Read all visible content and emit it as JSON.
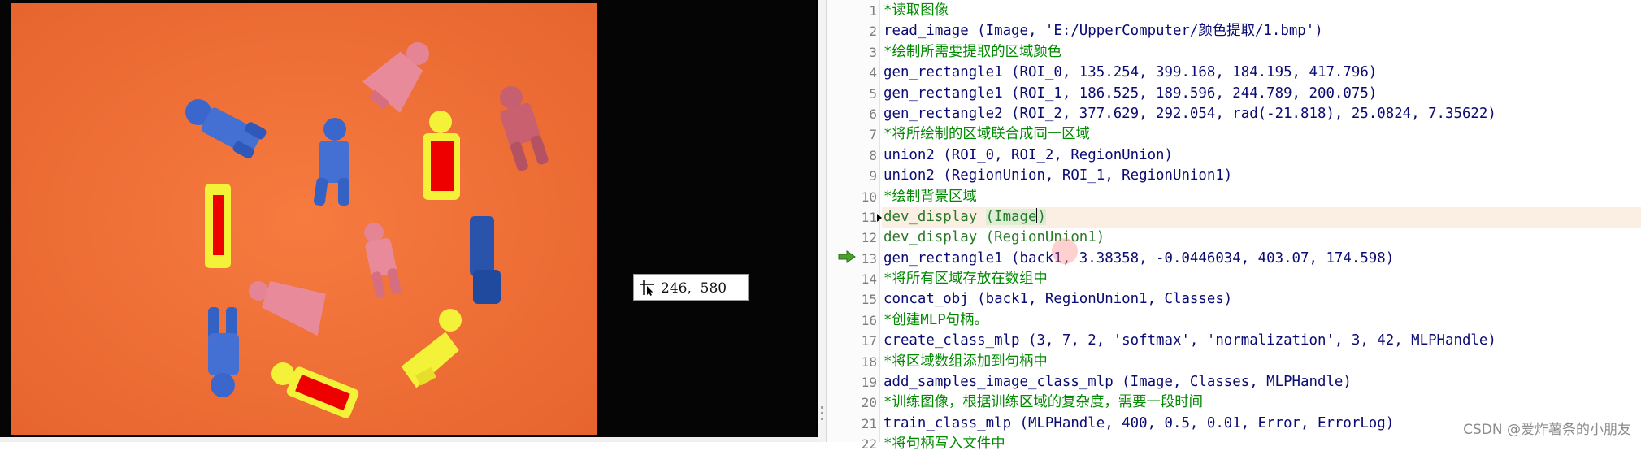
{
  "viewer": {
    "coord_readout": "246,  580"
  },
  "editor": {
    "lines": [
      {
        "n": "1",
        "text": "*读取图像",
        "kind": "comment"
      },
      {
        "n": "2",
        "text": "read_image (Image, 'E:/UpperComputer/颜色提取/1.bmp')",
        "kind": "call"
      },
      {
        "n": "3",
        "text": "*绘制所需要提取的区域颜色",
        "kind": "comment"
      },
      {
        "n": "4",
        "text": "gen_rectangle1 (ROI_0, 135.254, 399.168, 184.195, 417.796)",
        "kind": "call"
      },
      {
        "n": "5",
        "text": "gen_rectangle1 (ROI_1, 186.525, 189.596, 244.789, 200.075)",
        "kind": "call"
      },
      {
        "n": "6",
        "text": "gen_rectangle2 (ROI_2, 377.629, 292.054, rad(-21.818), 25.0824, 7.35622)",
        "kind": "call"
      },
      {
        "n": "7",
        "text": "*将所绘制的区域联合成同一区域",
        "kind": "comment"
      },
      {
        "n": "8",
        "text": "union2 (ROI_0, ROI_2, RegionUnion)",
        "kind": "call"
      },
      {
        "n": "9",
        "text": "union2 (RegionUnion, ROI_1, RegionUnion1)",
        "kind": "call"
      },
      {
        "n": "10",
        "text": "*绘制背景区域",
        "kind": "comment"
      },
      {
        "n": "11",
        "text": "dev_display (Image)",
        "kind": "struck",
        "current": true
      },
      {
        "n": "12",
        "text": "dev_display (RegionUnion1)",
        "kind": "struck"
      },
      {
        "n": "13",
        "text": "gen_rectangle1 (back1, 3.38358, -0.0446034, 403.07, 174.598)",
        "kind": "call",
        "exec": true
      },
      {
        "n": "14",
        "text": "*将所有区域存放在数组中",
        "kind": "comment"
      },
      {
        "n": "15",
        "text": "concat_obj (back1, RegionUnion1, Classes)",
        "kind": "call"
      },
      {
        "n": "16",
        "text": "*创建MLP句柄。",
        "kind": "comment"
      },
      {
        "n": "17",
        "text": "create_class_mlp (3, 7, 2, 'softmax', 'normalization', 3, 42, MLPHandle)",
        "kind": "call"
      },
      {
        "n": "18",
        "text": "*将区域数组添加到句柄中",
        "kind": "comment"
      },
      {
        "n": "19",
        "text": "add_samples_image_class_mlp (Image, Classes, MLPHandle)",
        "kind": "call"
      },
      {
        "n": "20",
        "text": "*训练图像，根据训练区域的复杂度，需要一段时间",
        "kind": "comment"
      },
      {
        "n": "21",
        "text": "train_class_mlp (MLPHandle, 400, 0.5, 0.01, Error, ErrorLog)",
        "kind": "call"
      },
      {
        "n": "22",
        "text": "*将句柄写入文件中",
        "kind": "comment"
      }
    ]
  },
  "watermark": "CSDN @爱炸薯条的小朋友",
  "colors": {
    "background_orange": "#f2703a",
    "figure_blue": "#3a64c8",
    "figure_pink": "#e17a8c",
    "figure_yellow": "#f2f030",
    "roi_red": "#ee0000",
    "comment_green": "#008a00",
    "code_navy": "#101080"
  }
}
